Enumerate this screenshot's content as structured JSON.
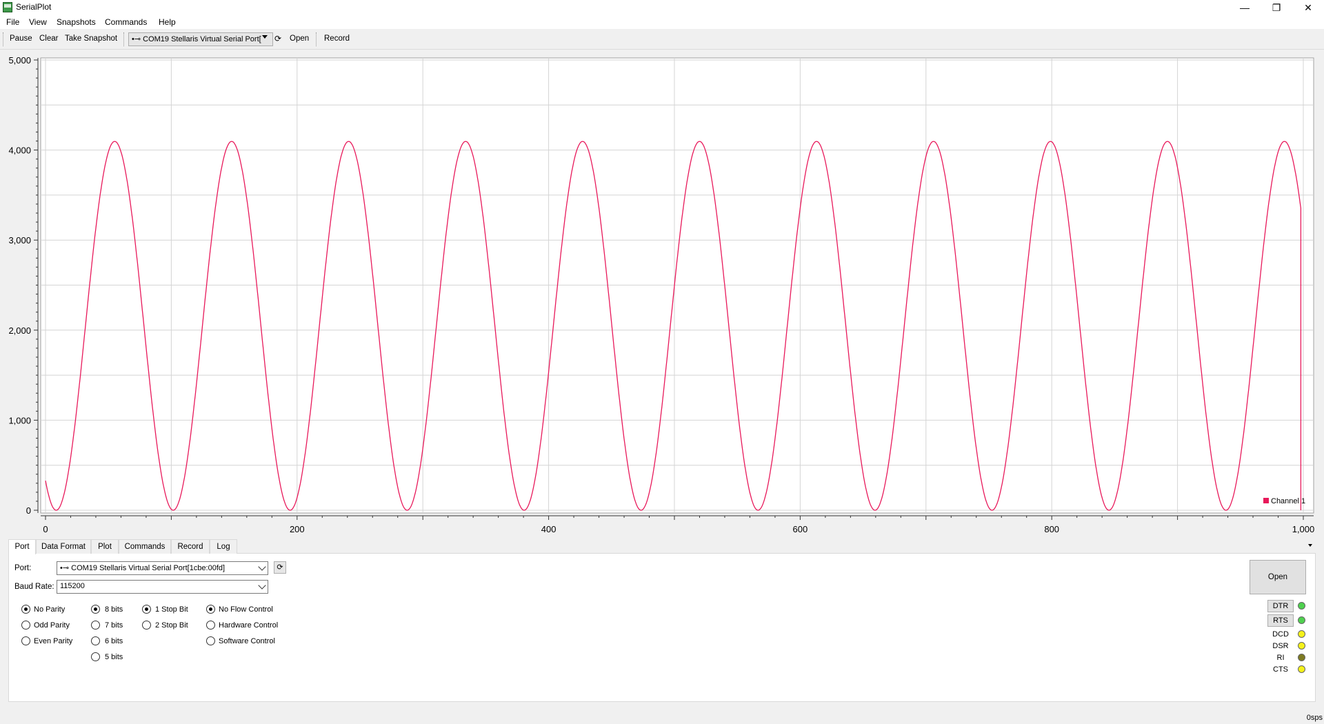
{
  "window": {
    "title": "SerialPlot",
    "minimize_glyph": "—",
    "maximize_glyph": "❐",
    "close_glyph": "✕"
  },
  "menu": [
    "File",
    "View",
    "Snapshots",
    "Commands",
    "Help"
  ],
  "toolbar": {
    "pause": "Pause",
    "clear": "Clear",
    "take_snapshot": "Take Snapshot",
    "port_combo": "•⊸ COM19 Stellaris Virtual Serial Port[",
    "refresh_icon": "refresh-icon",
    "open": "Open",
    "record": "Record"
  },
  "chart_data": {
    "type": "line",
    "title": "",
    "xlabel": "",
    "ylabel": "",
    "xlim": [
      0,
      1000
    ],
    "ylim": [
      0,
      5000
    ],
    "x_ticks": [
      0,
      200,
      400,
      600,
      800,
      1000
    ],
    "x_tick_labels": [
      "0",
      "200",
      "400",
      "600",
      "800",
      "1,000"
    ],
    "y_ticks": [
      0,
      1000,
      2000,
      3000,
      4000,
      5000
    ],
    "y_tick_labels": [
      "0",
      "1,000",
      "2,000",
      "3,000",
      "4,000",
      "5,000"
    ],
    "grid": true,
    "legend": "bottom-right",
    "series": [
      {
        "name": "Channel 1",
        "color": "#e8185a",
        "form": "sine",
        "amplitude": 2048,
        "offset": 2048,
        "period": 93,
        "first_peak_x": 55,
        "x_start": 0,
        "x_end": 998,
        "end_drop_to": 0
      }
    ]
  },
  "tabs": [
    "Port",
    "Data Format",
    "Plot",
    "Commands",
    "Record",
    "Log"
  ],
  "active_tab": "Port",
  "port_panel": {
    "port_label": "Port:",
    "port_value": "•⊸ COM19 Stellaris Virtual Serial Port[1cbe:00fd]",
    "baud_label": "Baud Rate:",
    "baud_value": "115200",
    "parity": [
      {
        "label": "No Parity",
        "checked": true
      },
      {
        "label": "Odd Parity",
        "checked": false
      },
      {
        "label": "Even Parity",
        "checked": false
      }
    ],
    "data_bits": [
      {
        "label": "8 bits",
        "checked": true
      },
      {
        "label": "7 bits",
        "checked": false
      },
      {
        "label": "6 bits",
        "checked": false
      },
      {
        "label": "5 bits",
        "checked": false
      }
    ],
    "stop_bits": [
      {
        "label": "1 Stop Bit",
        "checked": true
      },
      {
        "label": "2 Stop Bit",
        "checked": false
      }
    ],
    "flow_control": [
      {
        "label": "No Flow Control",
        "checked": true
      },
      {
        "label": "Hardware Control",
        "checked": false
      },
      {
        "label": "Software Control",
        "checked": false
      }
    ],
    "open_button": "Open",
    "signals": [
      {
        "label": "DTR",
        "button": true,
        "led_color": "#4fd14f"
      },
      {
        "label": "RTS",
        "button": true,
        "led_color": "#4fd14f"
      },
      {
        "label": "DCD",
        "button": false,
        "led_color": "#f5f21a"
      },
      {
        "label": "DSR",
        "button": false,
        "led_color": "#f5f21a"
      },
      {
        "label": "RI",
        "button": false,
        "led_color": "#7d7a22"
      },
      {
        "label": "CTS",
        "button": false,
        "led_color": "#f5f21a"
      }
    ]
  },
  "status": {
    "rate": "0sps"
  }
}
